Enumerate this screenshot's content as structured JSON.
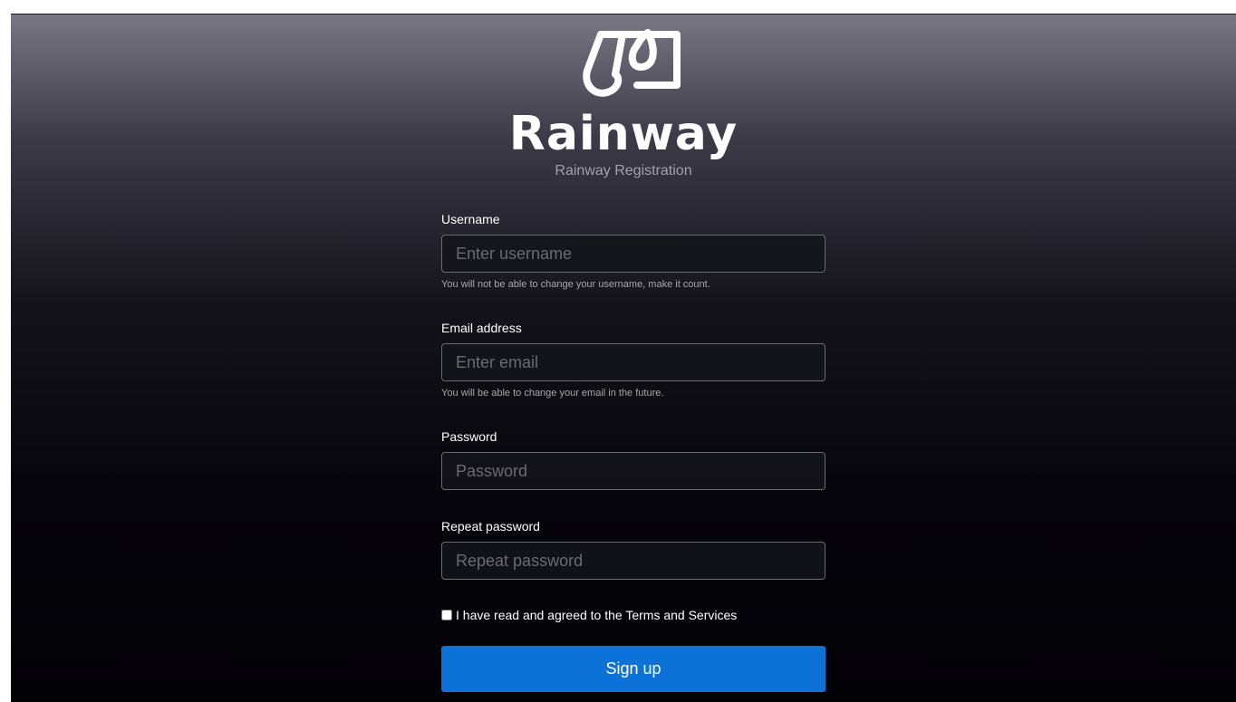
{
  "brand": {
    "name": "Rainway",
    "subtitle": "Rainway Registration",
    "logo_icon": "rainway-logo-icon"
  },
  "form": {
    "username": {
      "label": "Username",
      "placeholder": "Enter username",
      "value": "",
      "hint": "You will not be able to change your username, make it count."
    },
    "email": {
      "label": "Email address",
      "placeholder": "Enter email",
      "value": "",
      "hint": "You will be able to change your email in the future."
    },
    "password": {
      "label": "Password",
      "placeholder": "Password",
      "value": ""
    },
    "repeat_password": {
      "label": "Repeat password",
      "placeholder": "Repeat password",
      "value": ""
    },
    "terms": {
      "label": "I have read and agreed to the Terms and Services",
      "checked": false
    },
    "submit_label": "Sign up"
  },
  "colors": {
    "accent": "#0c72d8",
    "background_top": "#7a7784",
    "background_bottom": "#030207",
    "input_border": "#6b6b74"
  }
}
